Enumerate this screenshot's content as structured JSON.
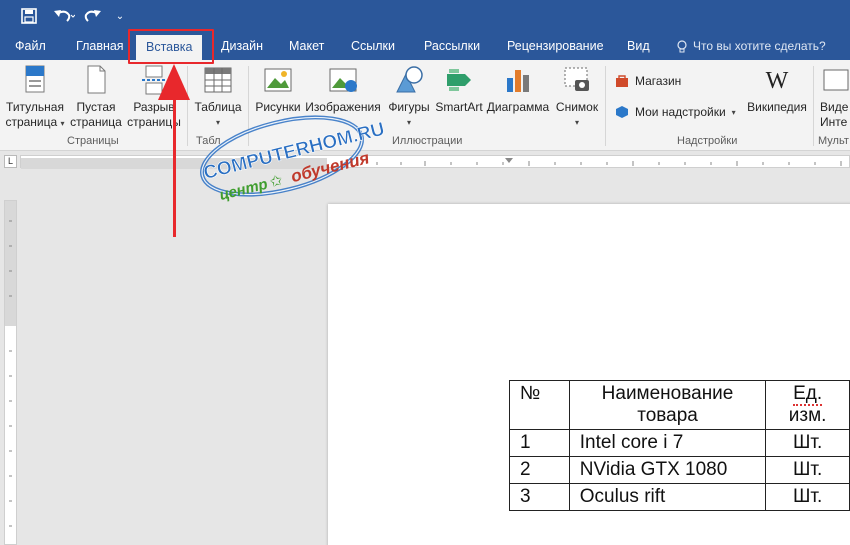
{
  "tabs": {
    "file": "Файл",
    "home": "Главная",
    "insert": "Вставка",
    "design": "Дизайн",
    "layout": "Макет",
    "references": "Ссылки",
    "mailings": "Рассылки",
    "review": "Рецензирование",
    "view": "Вид",
    "tell_me": "Что вы хотите сделать?"
  },
  "ribbon": {
    "cover_page_1": "Титульная",
    "cover_page_2": "страница",
    "blank_page_1": "Пустая",
    "blank_page_2": "страница",
    "page_break_1": "Разрыв",
    "page_break_2": "страницы",
    "table": "Таблица",
    "pictures": "Рисунки",
    "online_pictures": "Изображения",
    "shapes": "Фигуры",
    "smartart": "SmartArt",
    "chart": "Диаграмма",
    "screenshot": "Снимок",
    "store": "Магазин",
    "my_addins": "Мои надстройки",
    "wikipedia": "Википедия",
    "video_1": "Виде",
    "video_2": "Инте",
    "groups": {
      "pages": "Страницы",
      "tables": "Табл",
      "illustrations": "Иллюстрации",
      "addins": "Надстройки",
      "media": "Мульт"
    }
  },
  "ruler_corner": "L",
  "table": {
    "header": {
      "no": "№",
      "name_1": "Наименование",
      "name_2": "товара",
      "unit_1": "Ед.",
      "unit_2": "изм."
    },
    "rows": [
      {
        "no": "1",
        "name": "Intel core i 7",
        "unit": "Шт."
      },
      {
        "no": "2",
        "name": "NVidia GTX 1080",
        "unit": "Шт."
      },
      {
        "no": "3",
        "name": "Oculus rift",
        "unit": "Шт."
      }
    ]
  },
  "watermark": {
    "site": "COMPUTERHOM.RU",
    "line_1": "центр",
    "line_2": "обучения"
  },
  "colors": {
    "accent": "#2b579a",
    "highlight": "#e8282c",
    "watermark": "#2a6fc2",
    "watermark_green": "#3f9d2e"
  }
}
